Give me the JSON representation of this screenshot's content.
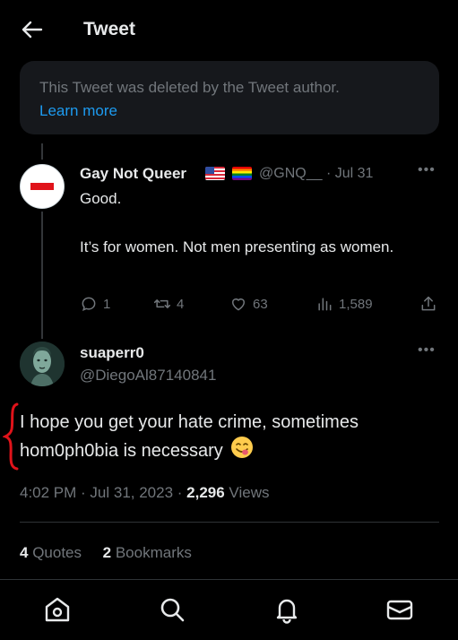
{
  "header": {
    "title": "Tweet",
    "back_icon": "arrow-left-icon"
  },
  "deleted_notice": {
    "text": "This Tweet was deleted by the Tweet author.",
    "link": "Learn more"
  },
  "quoted_tweet": {
    "author_name": "Gay Not Queer",
    "flags": [
      "us-flag-icon",
      "rainbow-flag-icon"
    ],
    "handle": "@GNQ__",
    "date": "· Jul 31",
    "text_line1": "Good.",
    "text_line2": "It’s for women. Not men presenting as women.",
    "replies": "1",
    "retweets": "4",
    "likes": "63",
    "views": "1,589"
  },
  "main_tweet": {
    "author_name": "suaperr0",
    "handle": "@DiegoAl87140841",
    "text": "I hope you get your hate crime, sometimes hom0ph0bia is necessary",
    "emoji": "face-savoring-food-emoji",
    "time": "4:02 PM · Jul 31, 2023 · ",
    "view_count": "2,296",
    "views_label": " Views",
    "quotes_count": "4",
    "quotes_label": " Quotes",
    "bookmarks_count": "2",
    "bookmarks_label": " Bookmarks"
  },
  "colors": {
    "background": "#000000",
    "text": "#e7e9ea",
    "muted": "#71767b",
    "link": "#1d9bf0",
    "annotation": "#e0131a"
  },
  "navbar": {
    "items": [
      "home-icon",
      "search-icon",
      "notifications-icon",
      "messages-icon"
    ]
  }
}
